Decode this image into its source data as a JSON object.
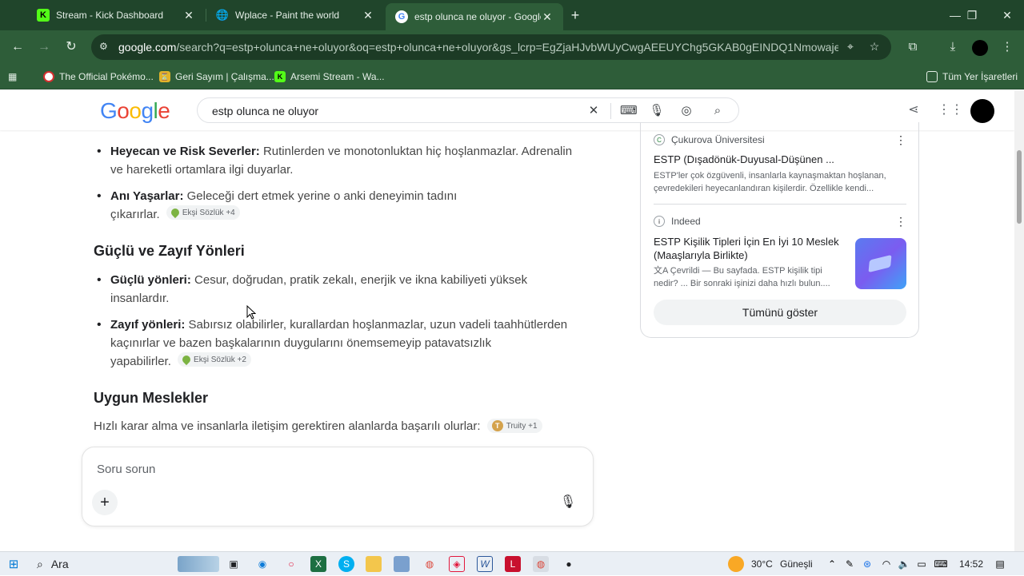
{
  "tabs": [
    {
      "title": "Stream - Kick Dashboard",
      "favicon": "kick-icon"
    },
    {
      "title": "Wplace - Paint the world",
      "favicon": "globe-icon"
    },
    {
      "title": "estp olunca ne oluyor - Google",
      "favicon": "google-icon"
    }
  ],
  "toolbar": {
    "url_host": "google.com",
    "url_rest": "/search?q=estp+olunca+ne+oluyor&oq=estp+olunca+ne+oluyor&gs_lcrp=EgZjaHJvbWUyCwgAEEUYChg5GKAB0gEINDQ1Nmowajeo AgCw..."
  },
  "bookmarks": [
    {
      "label": "The Official Pokémo..."
    },
    {
      "label": "Geri Sayım | Çalışma..."
    },
    {
      "label": "Arsemi Stream - Wa..."
    }
  ],
  "bookmarks_all": "Tüm Yer İşaretleri",
  "google": {
    "logo": [
      "G",
      "o",
      "o",
      "g",
      "l",
      "e"
    ],
    "query": "estp olunca ne oluyor"
  },
  "content": {
    "b1_bold": "Heyecan ve Risk Severler:",
    "b1_line1": " Rutinlerden ve monotonluktan hiç hoşlanmazlar. Adrenalin",
    "b1_line2": "ve hareketli ortamlara ilgi duyarlar.",
    "b2_bold": "Anı Yaşarlar:",
    "b2_line1": " Geleceği dert etmek yerine o anki deneyimin tadını",
    "b2_line2": "çıkarırlar.",
    "b2_chip": "Ekşi Sözlük +4",
    "h_strengths": "Güçlü ve Zayıf Yönleri",
    "b3_bold": "Güçlü yönleri:",
    "b3_line1": " Cesur, doğrudan, pratik zekalı, enerjik ve ikna kabiliyeti yüksek",
    "b3_line2": "insanlardır.",
    "b4_bold": "Zayıf yönleri:",
    "b4_line1": " Sabırsız olabilirler, kurallardan hoşlanmazlar, uzun vadeli taahhütlerden",
    "b4_line2": "kaçınırlar ve bazen başkalarının duygularını önemsemeyip patavatsızlık",
    "b4_line3": "yapabilirler.",
    "b4_chip": "Ekşi Sözlük +2",
    "h_jobs": "Uygun Meslekler",
    "jobs_para": "Hızlı karar alma ve insanlarla iletişim gerektiren alanlarda başarılı olurlar:",
    "jobs_chip": "Truity +1"
  },
  "ask": {
    "placeholder": "Soru sorun"
  },
  "panel": {
    "src1": "Çukurova Üniversitesi",
    "title1": "ESTP (Dışadönük-Duyusal-Düşünen ...",
    "snip1_l1": "ESTP'ler çok özgüvenli, insanlarla kaynaşmaktan hoşlanan,",
    "snip1_l2": "çevredekileri heyecanlandıran kişilerdir. Özellikle kendi...",
    "src2": "Indeed",
    "title2_l1": "ESTP Kişilik Tipleri İçin En İyi 10 Meslek",
    "title2_l2": "(Maaşlarıyla Birlikte)",
    "snip2_l1": "Çevrildi — Bu sayfada. ESTP kişilik tipi",
    "snip2_l2": "nedir? ... Bir sonraki işinizi daha hızlı bulun....",
    "show_all": "Tümünü göster"
  },
  "taskbar": {
    "search": "Ara",
    "weather": "30°C",
    "weather_desc": "Güneşli",
    "time": "14:52"
  },
  "colors": {
    "chrome_frame": "#20452b",
    "chrome_toolbar": "#2e5d39",
    "omnibox": "#1c3b25"
  }
}
